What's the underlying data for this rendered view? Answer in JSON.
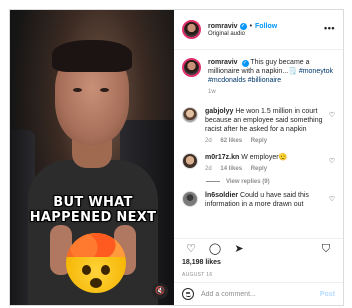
{
  "header": {
    "username": "romraviv",
    "follow_label": "Follow",
    "audio_label": "Original audio",
    "more_label": "•••"
  },
  "caption": {
    "username": "romraviv",
    "text": "This guy became a millionaire with a napkin...🗒️ ",
    "hashtags": "#moneytok #mcdonalds #billionaire",
    "time": "1w"
  },
  "video": {
    "overlay_line1": "BUT WHAT",
    "overlay_line2": "HAPPENED NEXT"
  },
  "comments": [
    {
      "username": "gabjolyy",
      "text": "He won 1.5 million in court because an employee said something racist after he asked for a napkin",
      "time": "2d",
      "likes": "62 likes",
      "reply_label": "Reply"
    },
    {
      "username": "m0r17z.kn",
      "text": "W employer🫡",
      "time": "2d",
      "likes": "14 likes",
      "reply_label": "Reply",
      "view_replies": "View replies (9)"
    },
    {
      "username": "ln6soldier",
      "text": "Could u have said this information in a more drawn out"
    }
  ],
  "actions": {
    "like_count": "18,198 likes",
    "date": "AUGUST 16"
  },
  "add_comment": {
    "placeholder": "Add a comment...",
    "post_label": "Post"
  },
  "colors": {
    "accent": "#0095f6",
    "post_disabled": "#b3dbff",
    "muted": "#8e8e8e"
  }
}
